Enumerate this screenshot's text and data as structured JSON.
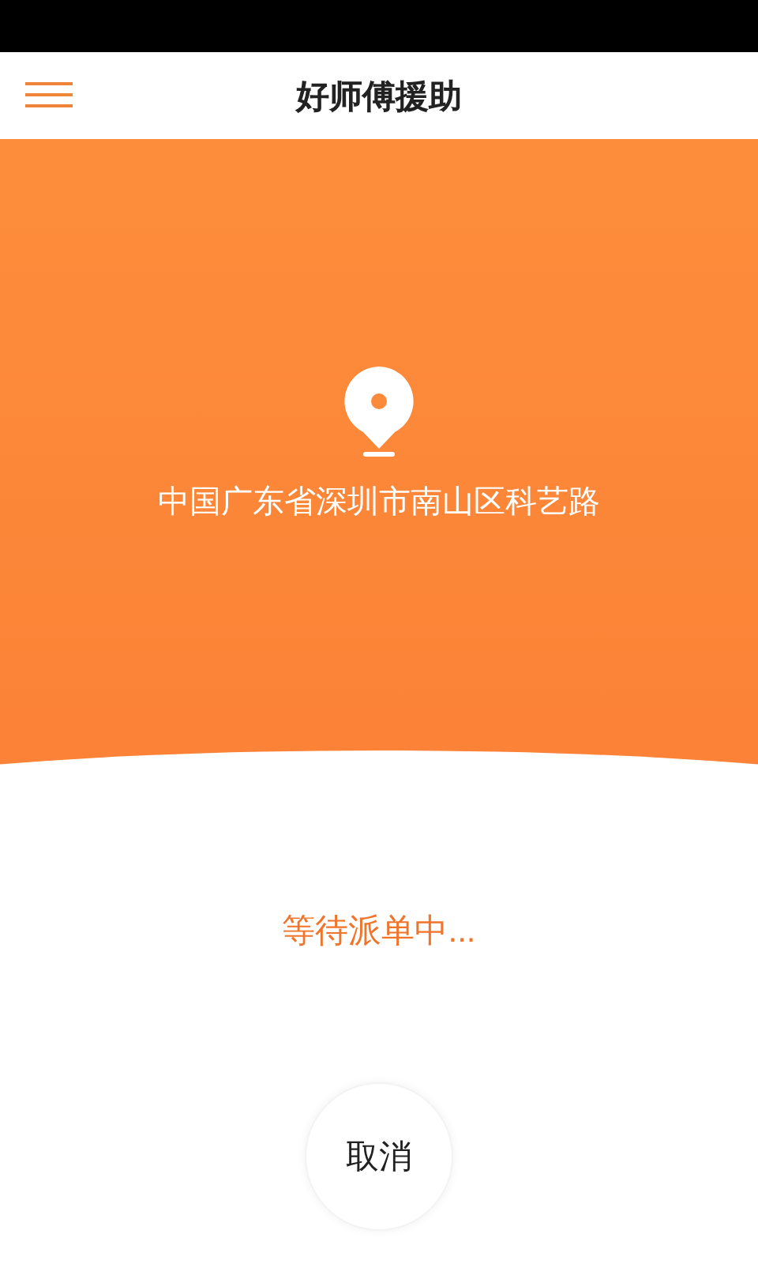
{
  "header": {
    "title": "好师傅援助"
  },
  "location": {
    "address": "中国广东省深圳市南山区科艺路"
  },
  "status": {
    "text": "等待派单中..."
  },
  "cancel_button": {
    "label": "取消"
  }
}
